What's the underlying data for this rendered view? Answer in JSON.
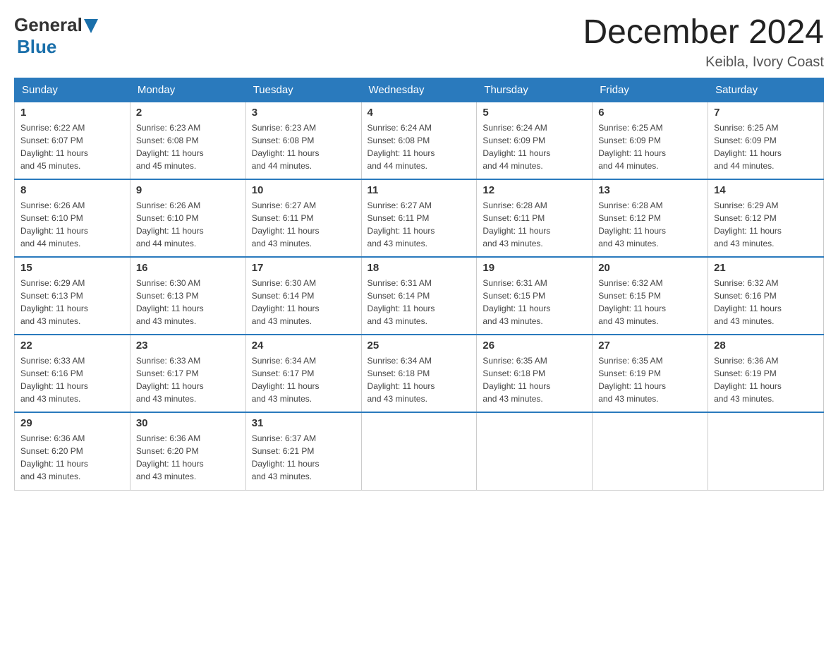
{
  "header": {
    "logo_general": "General",
    "logo_blue": "Blue",
    "month_title": "December 2024",
    "location": "Keibla, Ivory Coast"
  },
  "days_of_week": [
    "Sunday",
    "Monday",
    "Tuesday",
    "Wednesday",
    "Thursday",
    "Friday",
    "Saturday"
  ],
  "weeks": [
    [
      {
        "day": "1",
        "sunrise": "6:22 AM",
        "sunset": "6:07 PM",
        "daylight": "11 hours and 45 minutes."
      },
      {
        "day": "2",
        "sunrise": "6:23 AM",
        "sunset": "6:08 PM",
        "daylight": "11 hours and 45 minutes."
      },
      {
        "day": "3",
        "sunrise": "6:23 AM",
        "sunset": "6:08 PM",
        "daylight": "11 hours and 44 minutes."
      },
      {
        "day": "4",
        "sunrise": "6:24 AM",
        "sunset": "6:08 PM",
        "daylight": "11 hours and 44 minutes."
      },
      {
        "day": "5",
        "sunrise": "6:24 AM",
        "sunset": "6:09 PM",
        "daylight": "11 hours and 44 minutes."
      },
      {
        "day": "6",
        "sunrise": "6:25 AM",
        "sunset": "6:09 PM",
        "daylight": "11 hours and 44 minutes."
      },
      {
        "day": "7",
        "sunrise": "6:25 AM",
        "sunset": "6:09 PM",
        "daylight": "11 hours and 44 minutes."
      }
    ],
    [
      {
        "day": "8",
        "sunrise": "6:26 AM",
        "sunset": "6:10 PM",
        "daylight": "11 hours and 44 minutes."
      },
      {
        "day": "9",
        "sunrise": "6:26 AM",
        "sunset": "6:10 PM",
        "daylight": "11 hours and 44 minutes."
      },
      {
        "day": "10",
        "sunrise": "6:27 AM",
        "sunset": "6:11 PM",
        "daylight": "11 hours and 43 minutes."
      },
      {
        "day": "11",
        "sunrise": "6:27 AM",
        "sunset": "6:11 PM",
        "daylight": "11 hours and 43 minutes."
      },
      {
        "day": "12",
        "sunrise": "6:28 AM",
        "sunset": "6:11 PM",
        "daylight": "11 hours and 43 minutes."
      },
      {
        "day": "13",
        "sunrise": "6:28 AM",
        "sunset": "6:12 PM",
        "daylight": "11 hours and 43 minutes."
      },
      {
        "day": "14",
        "sunrise": "6:29 AM",
        "sunset": "6:12 PM",
        "daylight": "11 hours and 43 minutes."
      }
    ],
    [
      {
        "day": "15",
        "sunrise": "6:29 AM",
        "sunset": "6:13 PM",
        "daylight": "11 hours and 43 minutes."
      },
      {
        "day": "16",
        "sunrise": "6:30 AM",
        "sunset": "6:13 PM",
        "daylight": "11 hours and 43 minutes."
      },
      {
        "day": "17",
        "sunrise": "6:30 AM",
        "sunset": "6:14 PM",
        "daylight": "11 hours and 43 minutes."
      },
      {
        "day": "18",
        "sunrise": "6:31 AM",
        "sunset": "6:14 PM",
        "daylight": "11 hours and 43 minutes."
      },
      {
        "day": "19",
        "sunrise": "6:31 AM",
        "sunset": "6:15 PM",
        "daylight": "11 hours and 43 minutes."
      },
      {
        "day": "20",
        "sunrise": "6:32 AM",
        "sunset": "6:15 PM",
        "daylight": "11 hours and 43 minutes."
      },
      {
        "day": "21",
        "sunrise": "6:32 AM",
        "sunset": "6:16 PM",
        "daylight": "11 hours and 43 minutes."
      }
    ],
    [
      {
        "day": "22",
        "sunrise": "6:33 AM",
        "sunset": "6:16 PM",
        "daylight": "11 hours and 43 minutes."
      },
      {
        "day": "23",
        "sunrise": "6:33 AM",
        "sunset": "6:17 PM",
        "daylight": "11 hours and 43 minutes."
      },
      {
        "day": "24",
        "sunrise": "6:34 AM",
        "sunset": "6:17 PM",
        "daylight": "11 hours and 43 minutes."
      },
      {
        "day": "25",
        "sunrise": "6:34 AM",
        "sunset": "6:18 PM",
        "daylight": "11 hours and 43 minutes."
      },
      {
        "day": "26",
        "sunrise": "6:35 AM",
        "sunset": "6:18 PM",
        "daylight": "11 hours and 43 minutes."
      },
      {
        "day": "27",
        "sunrise": "6:35 AM",
        "sunset": "6:19 PM",
        "daylight": "11 hours and 43 minutes."
      },
      {
        "day": "28",
        "sunrise": "6:36 AM",
        "sunset": "6:19 PM",
        "daylight": "11 hours and 43 minutes."
      }
    ],
    [
      {
        "day": "29",
        "sunrise": "6:36 AM",
        "sunset": "6:20 PM",
        "daylight": "11 hours and 43 minutes."
      },
      {
        "day": "30",
        "sunrise": "6:36 AM",
        "sunset": "6:20 PM",
        "daylight": "11 hours and 43 minutes."
      },
      {
        "day": "31",
        "sunrise": "6:37 AM",
        "sunset": "6:21 PM",
        "daylight": "11 hours and 43 minutes."
      },
      {
        "day": "",
        "sunrise": "",
        "sunset": "",
        "daylight": ""
      },
      {
        "day": "",
        "sunrise": "",
        "sunset": "",
        "daylight": ""
      },
      {
        "day": "",
        "sunrise": "",
        "sunset": "",
        "daylight": ""
      },
      {
        "day": "",
        "sunrise": "",
        "sunset": "",
        "daylight": ""
      }
    ]
  ]
}
